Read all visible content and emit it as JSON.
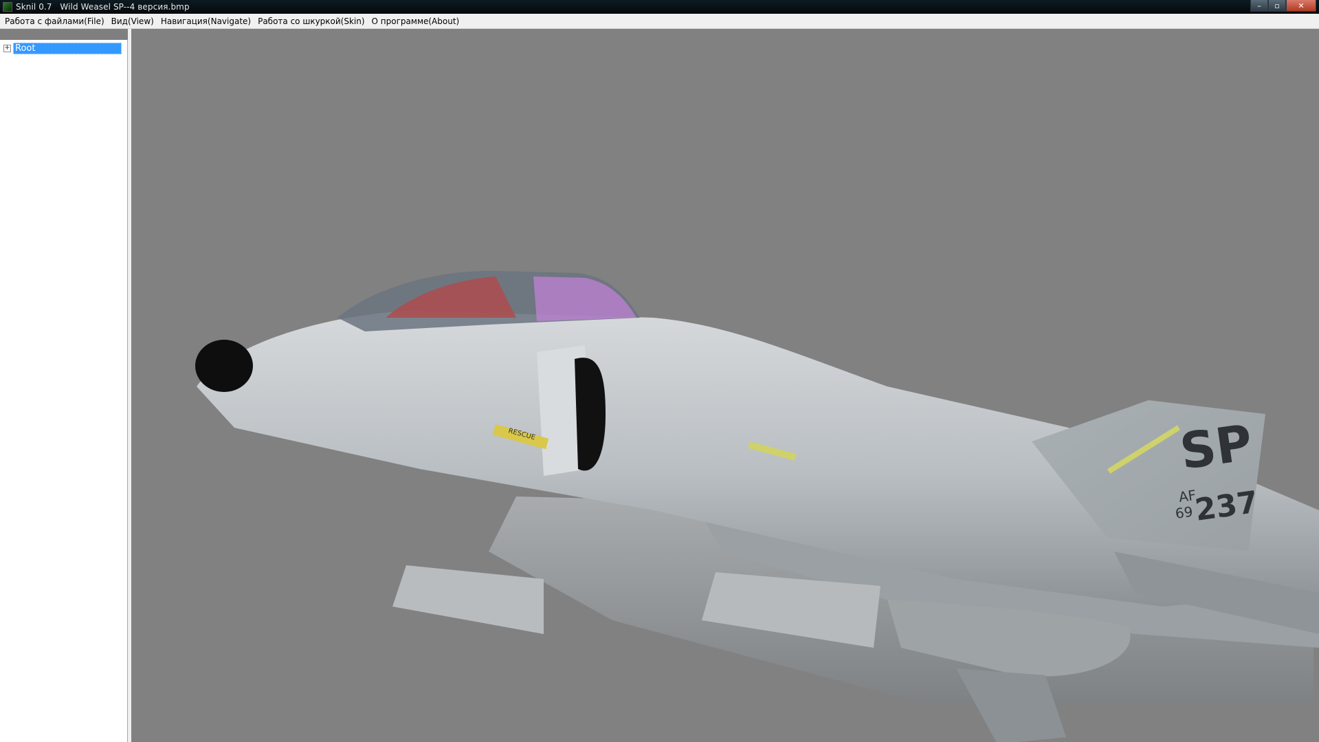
{
  "window": {
    "title": "Sknil 0.7   Wild Weasel SP--4 версия.bmp",
    "controls": {
      "minimize": "–",
      "maximize": "▫",
      "close": "✕"
    }
  },
  "menu": {
    "items": [
      "Работа с файлами(File)",
      "Вид(View)",
      "Навигация(Navigate)",
      "Работа со шкуркой(Skin)",
      "О программе(About)"
    ]
  },
  "tree": {
    "root": {
      "label": "Root",
      "expander": "+",
      "selected": true
    }
  },
  "viewport": {
    "background": "#818181",
    "model": {
      "tail_code": "SP",
      "tail_prefix_top": "AF",
      "tail_prefix_bottom": "69",
      "tail_number": "237",
      "decal_rescue": "RESCUE"
    }
  }
}
